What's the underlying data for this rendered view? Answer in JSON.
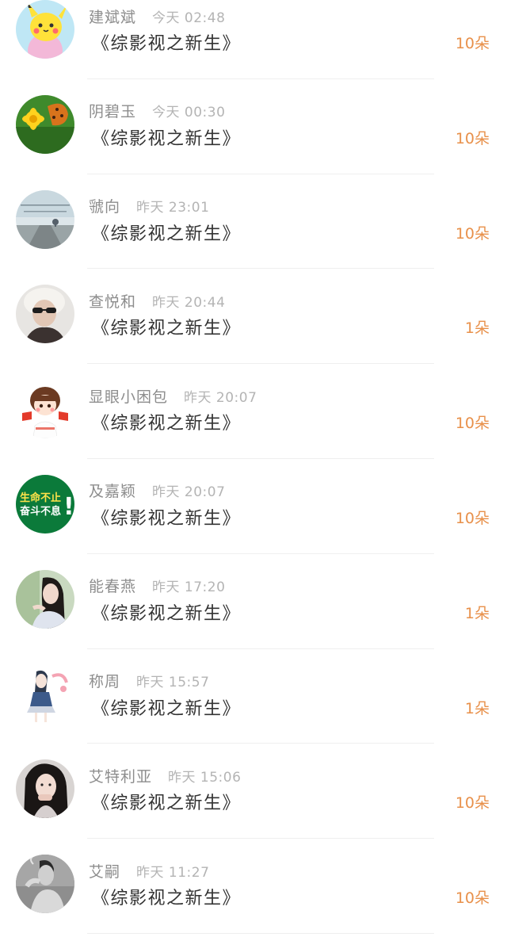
{
  "records": [
    {
      "name": "建斌斌",
      "time": "今天 02:48",
      "gift": "《综影视之新生》",
      "count": "10朵",
      "avatar_icon": "pikachu-avatar-icon"
    },
    {
      "name": "阴碧玉",
      "time": "今天 00:30",
      "gift": "《综影视之新生》",
      "count": "10朵",
      "avatar_icon": "butterfly-flower-avatar-icon"
    },
    {
      "name": "虢向",
      "time": "昨天 23:01",
      "gift": "《综影视之新生》",
      "count": "10朵",
      "avatar_icon": "sky-road-avatar-icon"
    },
    {
      "name": "查悦和",
      "time": "昨天 20:44",
      "gift": "《综影视之新生》",
      "count": "1朵",
      "avatar_icon": "sunglasses-person-avatar-icon"
    },
    {
      "name": "显眼小困包",
      "time": "昨天 20:07",
      "gift": "《综影视之新生》",
      "count": "10朵",
      "avatar_icon": "cartoon-girl-avatar-icon"
    },
    {
      "name": "及嘉颖",
      "time": "昨天 20:07",
      "gift": "《综影视之新生》",
      "count": "10朵",
      "avatar_icon": "green-slogan-avatar-icon"
    },
    {
      "name": "能春燕",
      "time": "昨天 17:20",
      "gift": "《综影视之新生》",
      "count": "1朵",
      "avatar_icon": "girl-portrait-avatar-icon"
    },
    {
      "name": "称周",
      "time": "昨天 15:57",
      "gift": "《综影视之新生》",
      "count": "1朵",
      "avatar_icon": "sketch-girl-avatar-icon"
    },
    {
      "name": "艾特利亚",
      "time": "昨天 15:06",
      "gift": "《综影视之新生》",
      "count": "10朵",
      "avatar_icon": "woman-portrait-avatar-icon"
    },
    {
      "name": "艾嗣",
      "time": "昨天 11:27",
      "gift": "《综影视之新生》",
      "count": "10朵",
      "avatar_icon": "smoking-man-avatar-icon"
    }
  ],
  "avatar_slogan": [
    "生命不止",
    "奋斗不息",
    "!"
  ],
  "colors": {
    "count": "#e8904a",
    "name": "#8d8d8d",
    "time": "#b4b4b4",
    "gift": "#333333"
  }
}
